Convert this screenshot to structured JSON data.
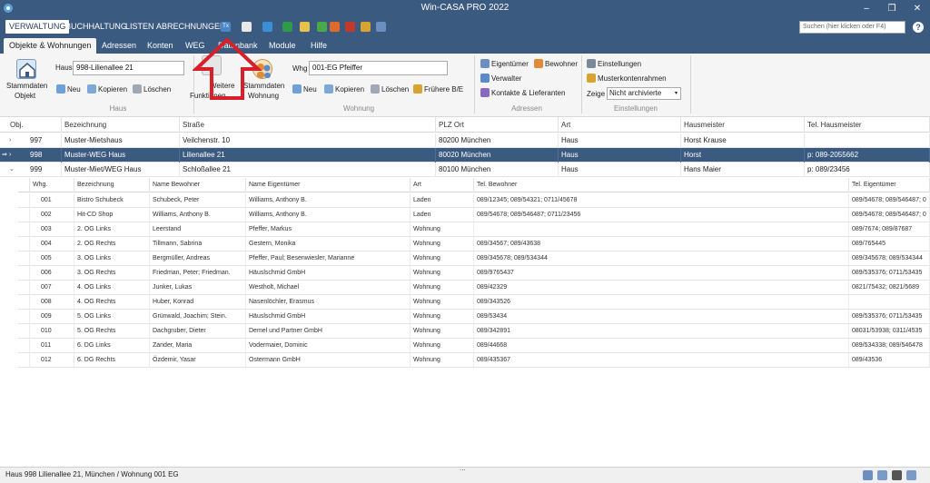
{
  "window": {
    "title": "Win-CASA PRO 2022",
    "min": "–",
    "restore": "❐",
    "close": "✕"
  },
  "menu": {
    "items": [
      "VERWALTUNG",
      "BUCHHALTUNG",
      "LISTEN",
      "ABRECHNUNGEN"
    ],
    "search_placeholder": "Suchen (hier klicken oder F4)",
    "help": "?",
    "tx": "Tx"
  },
  "tabs": [
    "Objekte & Wohnungen",
    "Adressen",
    "Konten",
    "WEG",
    "Datenbank",
    "Module",
    "Hilfe"
  ],
  "ribbon": {
    "stammdaten_objekt": [
      "Stammdaten",
      "Objekt"
    ],
    "haus_label": "Haus",
    "haus_value": "998-Lilienallee 21",
    "neu": "Neu",
    "kopieren": "Kopieren",
    "loeschen": "Löschen",
    "group_haus": "Haus",
    "weitere": [
      "Weitere",
      "Funktionen"
    ],
    "stammdaten_wohnung": [
      "Stammdaten",
      "Wohnung"
    ],
    "whg_label": "Whg",
    "whg_value": "001-EG  Pfeiffer",
    "fruehere": "Frühere B/E",
    "group_wohnung": "Wohnung",
    "eigentuemer": "Eigentümer",
    "bewohner": "Bewohner",
    "verwalter": "Verwalter",
    "kontakte": "Kontakte & Lieferanten",
    "group_adressen": "Adressen",
    "einstellungen": "Einstellungen",
    "musterkontenrahmen": "Musterkontenrahmen",
    "zeige": "Zeige",
    "zeige_value": "Nicht archivierte",
    "group_einstellungen": "Einstellungen"
  },
  "grid": {
    "headers": [
      "Obj.",
      "Bezeichnung",
      "Straße",
      "PLZ Ort",
      "Art",
      "Hausmeister",
      "Tel. Hausmeister"
    ],
    "rows": [
      {
        "obj": "997",
        "bez": "Muster-Mietshaus",
        "str": "Veilchenstr. 10",
        "plz": "80200 München",
        "art": "Haus",
        "hm": "Horst Krause",
        "tel": ""
      },
      {
        "obj": "998",
        "bez": "Muster-WEG Haus",
        "str": "Lilienallee 21",
        "plz": "80020 München",
        "art": "Haus",
        "hm": "Horst",
        "tel": "p: 089-2055662"
      },
      {
        "obj": "999",
        "bez": "Muster-Miet/WEG Haus",
        "str": "Schloßallee 21",
        "plz": "80100 München",
        "art": "Haus",
        "hm": "Hans Maier",
        "tel": "p: 089/23456"
      }
    ],
    "sub_headers": [
      "Whg.",
      "Bezeichnung",
      "Name Bewohner",
      "Name Eigentümer",
      "Art",
      "Tel. Bewohner",
      "Tel. Eigentümer"
    ],
    "sub_rows": [
      [
        "001",
        "Bistro Schubeck",
        "Schubeck, Peter",
        "Williams, Anthony B.",
        "Laden",
        "089/12345; 089/54321; 0711/45678",
        "089/54678; 089/546487; 0"
      ],
      [
        "002",
        "Hit-CD Shop",
        "Williams, Anthony B.",
        "Williams, Anthony B.",
        "Laden",
        "089/54678; 089/546487; 0711/23456",
        "089/54678; 089/546487; 0"
      ],
      [
        "003",
        "2. OG Links",
        "Leerstand",
        "Pfeffer, Markus",
        "Wohnung",
        "",
        "089/7674; 089/87687"
      ],
      [
        "004",
        "2. OG Rechts",
        "Tillmann, Sabrina",
        "Gestern, Monika",
        "Wohnung",
        "089/34567; 089/43638",
        "089/765445"
      ],
      [
        "005",
        "3. OG Links",
        "Bergmüller, Andreas",
        "Pfeffer, Paul; Besenwiesler, Marianne",
        "Wohnung",
        "089/345678; 089/534344",
        "089/345678; 089/534344"
      ],
      [
        "006",
        "3. OG Rechts",
        "Friedman, Peter; Friedman.",
        "Häuslschmid GmbH",
        "Wohnung",
        "089/9765437",
        "089/535376; 0711/53435"
      ],
      [
        "007",
        "4. OG Links",
        "Junker, Lukas",
        "Westholt, Michael",
        "Wohnung",
        "089/42329",
        "0821/75432; 0821/5689"
      ],
      [
        "008",
        "4. OG Rechts",
        "Huber, Konrad",
        "Nasenlöchler, Erasmus",
        "Wohnung",
        "089/343526",
        ""
      ],
      [
        "009",
        "5. OG Links",
        "Grünwald, Joachim; Stein.",
        "Häuslschmid GmbH",
        "Wohnung",
        "089/53434",
        "089/535376; 0711/53435"
      ],
      [
        "010",
        "5. OG Rechts",
        "Dachgruber, Dieter",
        "Demel und Partner GmbH",
        "Wohnung",
        "089/342891",
        "08031/53938; 0311/4535"
      ],
      [
        "011",
        "6. DG Links",
        "Zander, Maria",
        "Vodermaier, Dominic",
        "Wohnung",
        "089/44668",
        "089/534338; 089/546478"
      ],
      [
        "012",
        "6. DG Rechts",
        "Özdemir, Yasar",
        "Ostermann GmbH",
        "Wohnung",
        "089/435367",
        "089/43536"
      ]
    ]
  },
  "status": {
    "text": "Haus 998 Lilienallee 21, München / Wohnung 001 EG",
    "dots": "..."
  },
  "colors": {
    "primary": "#3b5a80",
    "annotation_arrow": "#d8202a"
  }
}
